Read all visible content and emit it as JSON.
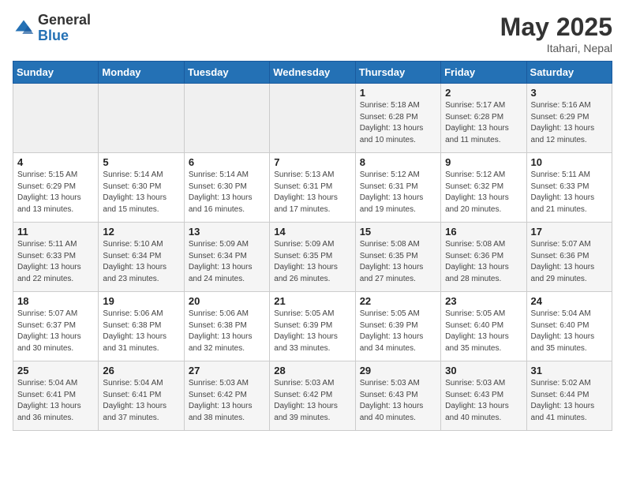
{
  "header": {
    "logo_general": "General",
    "logo_blue": "Blue",
    "month": "May 2025",
    "location": "Itahari, Nepal"
  },
  "days_of_week": [
    "Sunday",
    "Monday",
    "Tuesday",
    "Wednesday",
    "Thursday",
    "Friday",
    "Saturday"
  ],
  "weeks": [
    [
      {
        "day": "",
        "info": ""
      },
      {
        "day": "",
        "info": ""
      },
      {
        "day": "",
        "info": ""
      },
      {
        "day": "",
        "info": ""
      },
      {
        "day": "1",
        "info": "Sunrise: 5:18 AM\nSunset: 6:28 PM\nDaylight: 13 hours\nand 10 minutes."
      },
      {
        "day": "2",
        "info": "Sunrise: 5:17 AM\nSunset: 6:28 PM\nDaylight: 13 hours\nand 11 minutes."
      },
      {
        "day": "3",
        "info": "Sunrise: 5:16 AM\nSunset: 6:29 PM\nDaylight: 13 hours\nand 12 minutes."
      }
    ],
    [
      {
        "day": "4",
        "info": "Sunrise: 5:15 AM\nSunset: 6:29 PM\nDaylight: 13 hours\nand 13 minutes."
      },
      {
        "day": "5",
        "info": "Sunrise: 5:14 AM\nSunset: 6:30 PM\nDaylight: 13 hours\nand 15 minutes."
      },
      {
        "day": "6",
        "info": "Sunrise: 5:14 AM\nSunset: 6:30 PM\nDaylight: 13 hours\nand 16 minutes."
      },
      {
        "day": "7",
        "info": "Sunrise: 5:13 AM\nSunset: 6:31 PM\nDaylight: 13 hours\nand 17 minutes."
      },
      {
        "day": "8",
        "info": "Sunrise: 5:12 AM\nSunset: 6:31 PM\nDaylight: 13 hours\nand 19 minutes."
      },
      {
        "day": "9",
        "info": "Sunrise: 5:12 AM\nSunset: 6:32 PM\nDaylight: 13 hours\nand 20 minutes."
      },
      {
        "day": "10",
        "info": "Sunrise: 5:11 AM\nSunset: 6:33 PM\nDaylight: 13 hours\nand 21 minutes."
      }
    ],
    [
      {
        "day": "11",
        "info": "Sunrise: 5:11 AM\nSunset: 6:33 PM\nDaylight: 13 hours\nand 22 minutes."
      },
      {
        "day": "12",
        "info": "Sunrise: 5:10 AM\nSunset: 6:34 PM\nDaylight: 13 hours\nand 23 minutes."
      },
      {
        "day": "13",
        "info": "Sunrise: 5:09 AM\nSunset: 6:34 PM\nDaylight: 13 hours\nand 24 minutes."
      },
      {
        "day": "14",
        "info": "Sunrise: 5:09 AM\nSunset: 6:35 PM\nDaylight: 13 hours\nand 26 minutes."
      },
      {
        "day": "15",
        "info": "Sunrise: 5:08 AM\nSunset: 6:35 PM\nDaylight: 13 hours\nand 27 minutes."
      },
      {
        "day": "16",
        "info": "Sunrise: 5:08 AM\nSunset: 6:36 PM\nDaylight: 13 hours\nand 28 minutes."
      },
      {
        "day": "17",
        "info": "Sunrise: 5:07 AM\nSunset: 6:36 PM\nDaylight: 13 hours\nand 29 minutes."
      }
    ],
    [
      {
        "day": "18",
        "info": "Sunrise: 5:07 AM\nSunset: 6:37 PM\nDaylight: 13 hours\nand 30 minutes."
      },
      {
        "day": "19",
        "info": "Sunrise: 5:06 AM\nSunset: 6:38 PM\nDaylight: 13 hours\nand 31 minutes."
      },
      {
        "day": "20",
        "info": "Sunrise: 5:06 AM\nSunset: 6:38 PM\nDaylight: 13 hours\nand 32 minutes."
      },
      {
        "day": "21",
        "info": "Sunrise: 5:05 AM\nSunset: 6:39 PM\nDaylight: 13 hours\nand 33 minutes."
      },
      {
        "day": "22",
        "info": "Sunrise: 5:05 AM\nSunset: 6:39 PM\nDaylight: 13 hours\nand 34 minutes."
      },
      {
        "day": "23",
        "info": "Sunrise: 5:05 AM\nSunset: 6:40 PM\nDaylight: 13 hours\nand 35 minutes."
      },
      {
        "day": "24",
        "info": "Sunrise: 5:04 AM\nSunset: 6:40 PM\nDaylight: 13 hours\nand 35 minutes."
      }
    ],
    [
      {
        "day": "25",
        "info": "Sunrise: 5:04 AM\nSunset: 6:41 PM\nDaylight: 13 hours\nand 36 minutes."
      },
      {
        "day": "26",
        "info": "Sunrise: 5:04 AM\nSunset: 6:41 PM\nDaylight: 13 hours\nand 37 minutes."
      },
      {
        "day": "27",
        "info": "Sunrise: 5:03 AM\nSunset: 6:42 PM\nDaylight: 13 hours\nand 38 minutes."
      },
      {
        "day": "28",
        "info": "Sunrise: 5:03 AM\nSunset: 6:42 PM\nDaylight: 13 hours\nand 39 minutes."
      },
      {
        "day": "29",
        "info": "Sunrise: 5:03 AM\nSunset: 6:43 PM\nDaylight: 13 hours\nand 40 minutes."
      },
      {
        "day": "30",
        "info": "Sunrise: 5:03 AM\nSunset: 6:43 PM\nDaylight: 13 hours\nand 40 minutes."
      },
      {
        "day": "31",
        "info": "Sunrise: 5:02 AM\nSunset: 6:44 PM\nDaylight: 13 hours\nand 41 minutes."
      }
    ]
  ]
}
